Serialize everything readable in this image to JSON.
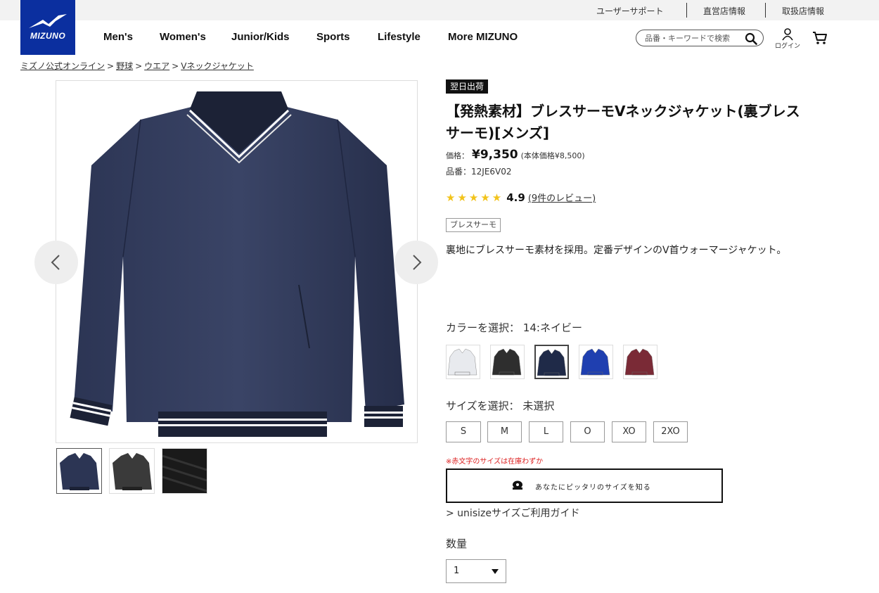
{
  "utility_links": [
    "ユーザーサポート",
    "直営店情報",
    "取扱店情報"
  ],
  "logo": {
    "text": "MIZUNO",
    "color": "#0b2f9f"
  },
  "nav": [
    "Men's",
    "Women's",
    "Junior/Kids",
    "Sports",
    "Lifestyle",
    "More MIZUNO"
  ],
  "search": {
    "placeholder": "品番・キーワードで検索"
  },
  "login_label": "ログイン",
  "breadcrumb": [
    {
      "label": "ミズノ公式オンライン"
    },
    {
      "label": "野球"
    },
    {
      "label": "ウエア"
    },
    {
      "label": "Vネックジャケット"
    }
  ],
  "product": {
    "badge": "翌日出荷",
    "title": "【発熱素材】ブレスサーモVネックジャケット(裏ブレスサーモ)[メンズ]",
    "price_label": "価格：",
    "price": "¥9,350",
    "price_note": "(本体価格¥8,500)",
    "sku_label": "品番：",
    "sku": "12JE6V02",
    "rating": 4.9,
    "rating_text": "4.9",
    "reviews_link": "(9件のレビュー)",
    "tag": "ブレスサーモ",
    "description": "裏地にブレスサーモ素材を採用。定番デザインのV首ウォーマージャケット。"
  },
  "color_select": {
    "label": "カラーを選択：",
    "selected": "14:ネイビー",
    "swatches": [
      {
        "color": "#e8eaee",
        "selected": false
      },
      {
        "color": "#2e2e2e",
        "selected": false
      },
      {
        "color": "#1f2a48",
        "selected": true
      },
      {
        "color": "#1f3fb0",
        "selected": false
      },
      {
        "color": "#7a2a36",
        "selected": false
      }
    ]
  },
  "size_select": {
    "label": "サイズを選択：",
    "selected": "未選択",
    "sizes": [
      "S",
      "M",
      "L",
      "O",
      "XO",
      "2XO"
    ]
  },
  "stock_note": "※赤文字のサイズは在庫わずか",
  "fit_button": "あなたにピッタリのサイズを知る",
  "size_guide": "> unisizeサイズご利用ガイド",
  "quantity": {
    "label": "数量",
    "value": "1"
  }
}
